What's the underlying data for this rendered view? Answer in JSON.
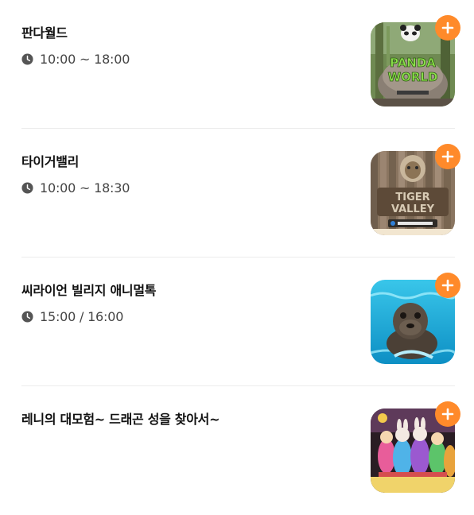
{
  "items": [
    {
      "title": "판다월드",
      "time": "10:00 ~ 18:00",
      "image": "panda-world-entrance-photo"
    },
    {
      "title": "타이거밸리",
      "time": "10:00 ~ 18:30",
      "image": "tiger-valley-sign-photo"
    },
    {
      "title": "씨라이언 빌리지 애니멀톡",
      "time": "15:00 / 16:00",
      "image": "sea-lion-swimming-photo"
    },
    {
      "title": "레니의 대모험~ 드래곤 성을 찾아서~",
      "time": "",
      "image": "lenny-parade-performers-photo"
    }
  ],
  "icons": {
    "clock": "clock-icon",
    "add": "plus-icon"
  },
  "colors": {
    "accent": "#ff8a2a",
    "title": "#111111",
    "time": "#444444",
    "divider": "#ececec"
  }
}
